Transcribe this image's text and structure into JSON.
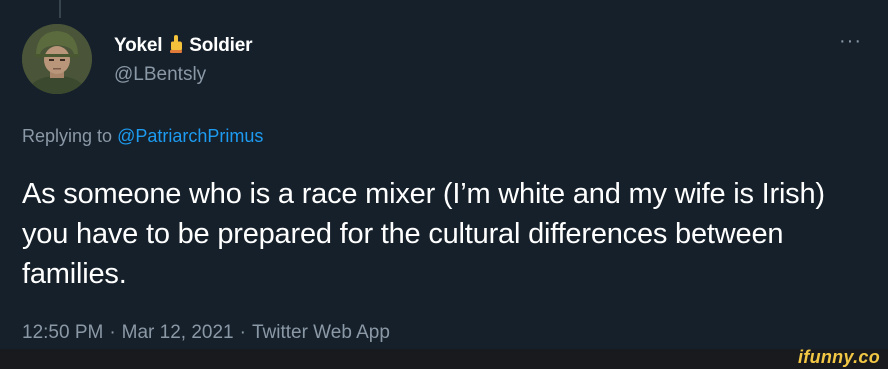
{
  "author": {
    "display_name_part1": "Yokel",
    "display_name_emoji": "pointing-up-hand-emoji",
    "display_name_part2": "Soldier",
    "handle": "@LBentsly"
  },
  "more_menu_label": "···",
  "reply": {
    "prefix": "Replying to",
    "mention": "@PatriarchPrimus"
  },
  "tweet": {
    "text": "As someone who is a race mixer (I’m white and my wife is Irish) you have to be prepared for the cultural differences between families."
  },
  "meta": {
    "time": "12:50 PM",
    "separator": "·",
    "date": "Mar 12, 2021",
    "source": "Twitter Web App"
  },
  "watermark": {
    "text": "ifunny.co"
  },
  "colors": {
    "background": "#15202b",
    "secondary_text": "#8b98a5",
    "link": "#1d9bf0",
    "watermark": "#f2c744"
  }
}
